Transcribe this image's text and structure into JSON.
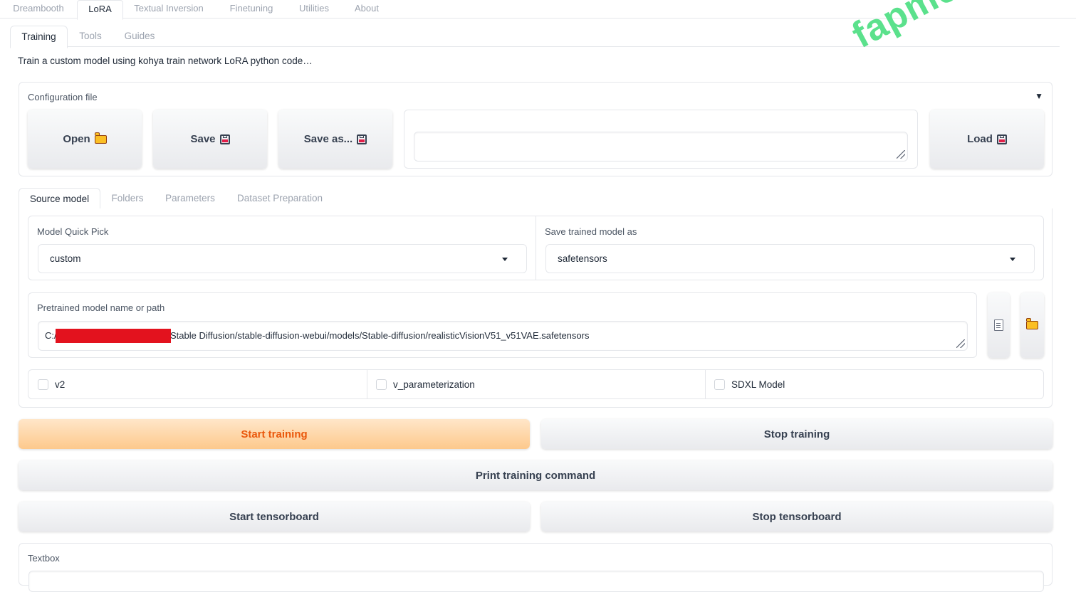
{
  "top_tabs": [
    {
      "label": "Dreambooth"
    },
    {
      "label": "LoRA"
    },
    {
      "label": "Textual Inversion"
    },
    {
      "label": "Finetuning"
    },
    {
      "label": "Utilities"
    },
    {
      "label": "About"
    }
  ],
  "active_top_tab": "LoRA",
  "sub_tabs": [
    {
      "label": "Training"
    },
    {
      "label": "Tools"
    },
    {
      "label": "Guides"
    }
  ],
  "description": "Train a custom model using kohya train network LoRA python code…",
  "config": {
    "label": "Configuration file",
    "open_label": "Open",
    "save_label": "Save",
    "save_as_label": "Save as...",
    "load_label": "Load",
    "collapse_glyph": "▼",
    "file_path_value": ""
  },
  "section_tabs": [
    {
      "label": "Source model"
    },
    {
      "label": "Folders"
    },
    {
      "label": "Parameters"
    },
    {
      "label": "Dataset Preparation"
    }
  ],
  "source_model": {
    "quick_pick_label": "Model Quick Pick",
    "quick_pick_value": "custom",
    "save_as_label": "Save trained model as",
    "save_as_value": "safetensors",
    "pretrained_label": "Pretrained model name or path",
    "pretrained_prefix": "C:/",
    "pretrained_suffix": "Stable Diffusion/stable-diffusion-webui/models/Stable-diffusion/realisticVisionV51_v51VAE.safetensors",
    "checkboxes": [
      {
        "label": "v2",
        "checked": false
      },
      {
        "label": "v_parameterization",
        "checked": false
      },
      {
        "label": "SDXL Model",
        "checked": false
      }
    ]
  },
  "actions": {
    "start_training": "Start training",
    "stop_training": "Stop training",
    "print_command": "Print training command",
    "start_tensorboard": "Start tensorboard",
    "stop_tensorboard": "Stop tensorboard"
  },
  "textbox": {
    "label": "Textbox"
  },
  "watermark": "fapmenu.com",
  "colors": {
    "accent": "#ea580c",
    "primary_bg": "#fdc98c",
    "watermark": "#4ade80",
    "redaction": "#e3121e"
  }
}
